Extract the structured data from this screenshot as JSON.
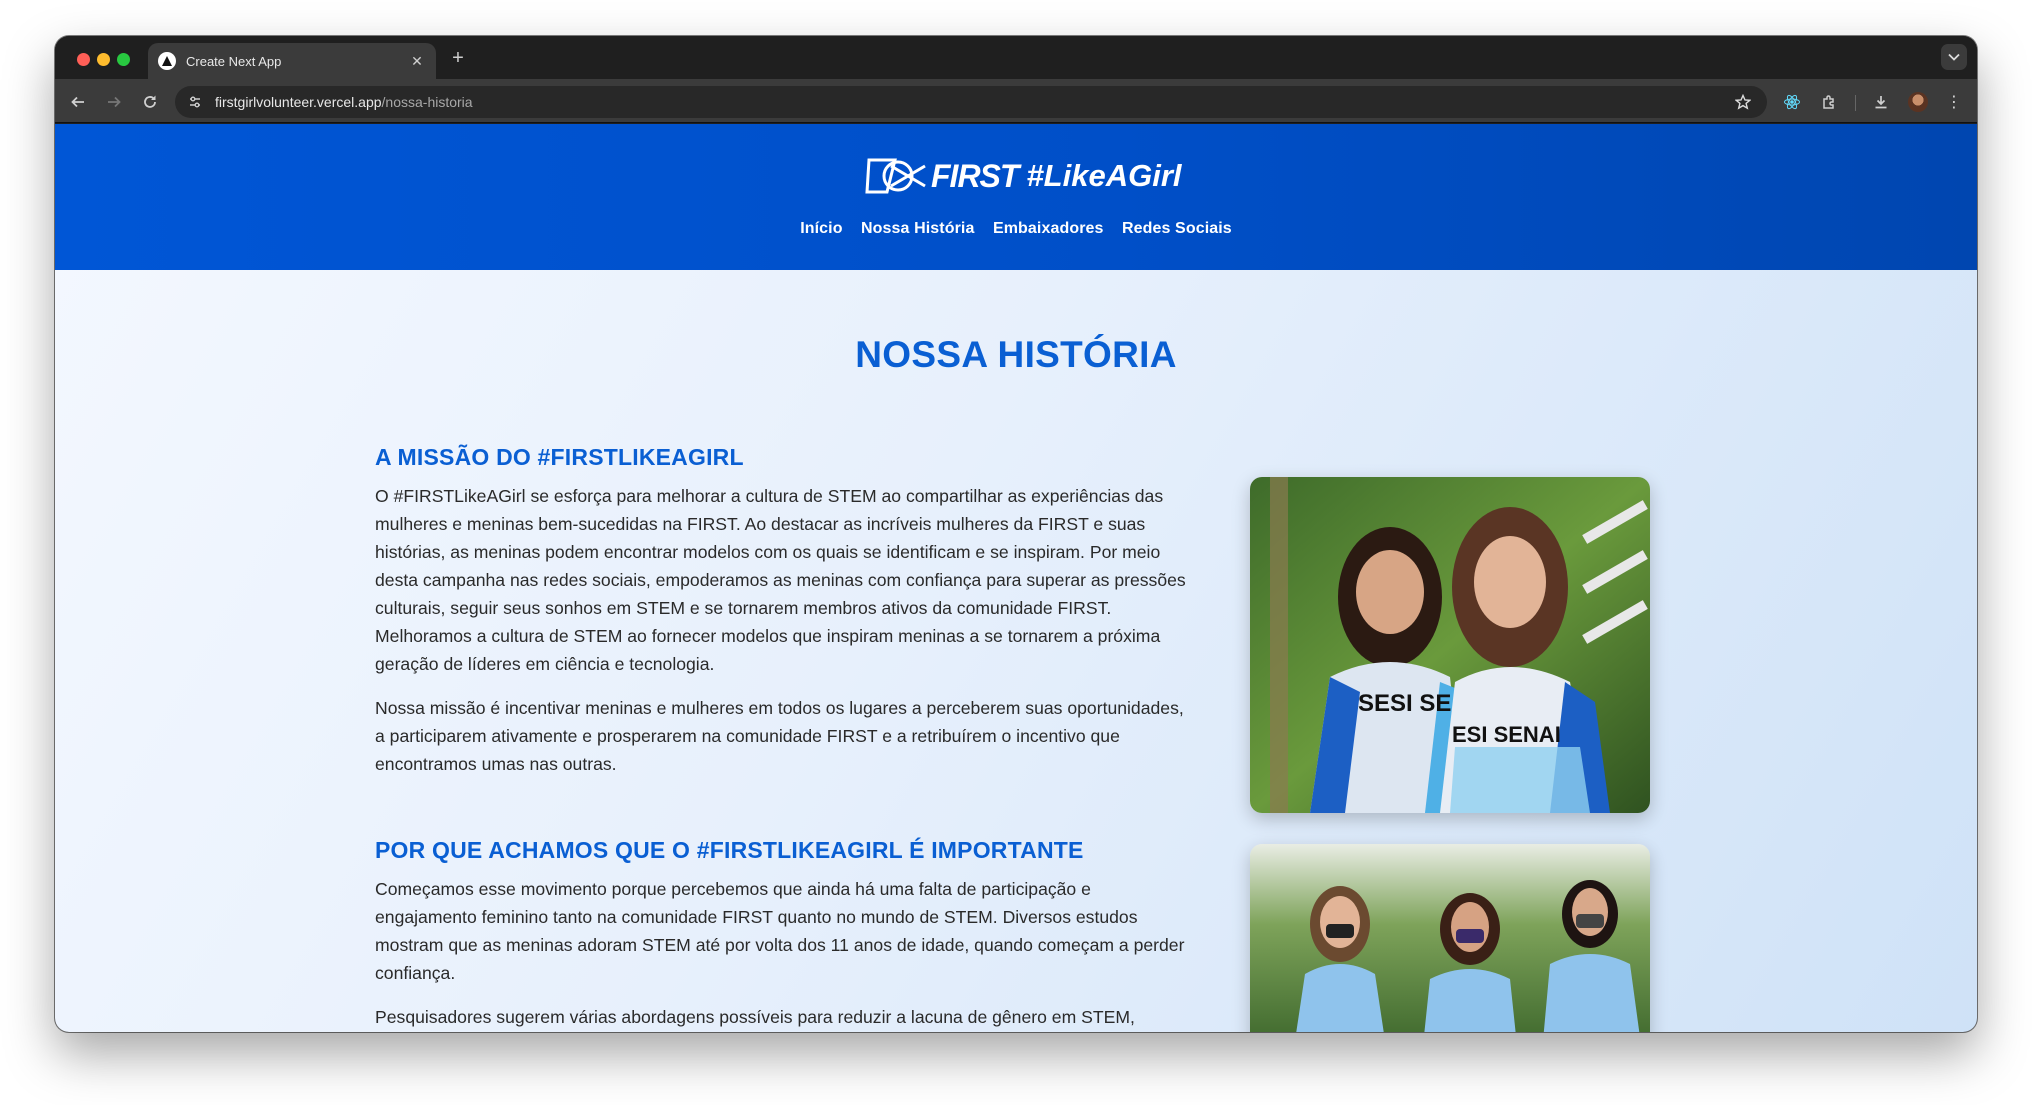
{
  "browser": {
    "tab_title": "Create Next App",
    "tab_close_icon": "close-icon",
    "new_tab_label": "+",
    "url_host": "firstgirlvolunteer.vercel.app",
    "url_path": "/nossa-historia"
  },
  "header": {
    "logo_first": "FIRST",
    "logo_hashtag": "#LikeAGirl",
    "nav": [
      "Início",
      "Nossa História",
      "Embaixadores",
      "Redes Sociais"
    ]
  },
  "page": {
    "title": "NOSSA HISTÓRIA",
    "sections": [
      {
        "heading": "A MISSÃO DO #FIRSTLIKEAGIRL",
        "paragraphs": [
          "O #FIRSTLikeAGirl se esforça para melhorar a cultura de STEM ao compartilhar as experiências das mulheres e meninas bem-sucedidas na FIRST. Ao destacar as incríveis mulheres da FIRST e suas histórias, as meninas podem encontrar modelos com os quais se identificam e se inspiram. Por meio desta campanha nas redes sociais, empoderamos as meninas com confiança para superar as pressões culturais, seguir seus sonhos em STEM e se tornarem membros ativos da comunidade FIRST. Melhoramos a cultura de STEM ao fornecer modelos que inspiram meninas a se tornarem a próxima geração de líderes em ciência e tecnologia.",
          "Nossa missão é incentivar meninas e mulheres em todos os lugares a perceberem suas oportunidades, a participarem ativamente e prosperarem na comunidade FIRST e a retribuírem o incentivo que encontramos umas nas outras."
        ]
      },
      {
        "heading": "POR QUE ACHAMOS QUE O #FIRSTLIKEAGIRL É IMPORTANTE",
        "paragraphs": [
          "Começamos esse movimento porque percebemos que ainda há uma falta de participação e engajamento feminino tanto na comunidade FIRST quanto no mundo de STEM. Diversos estudos mostram que as meninas adoram STEM até por volta dos 11 anos de idade, quando começam a perder confiança.",
          "Pesquisadores sugerem várias abordagens possíveis para reduzir a lacuna de gênero em STEM,"
        ]
      }
    ],
    "photos": [
      {
        "shirt_text_1": "SESI SE",
        "shirt_text_2": "ESI SENAI"
      }
    ]
  }
}
